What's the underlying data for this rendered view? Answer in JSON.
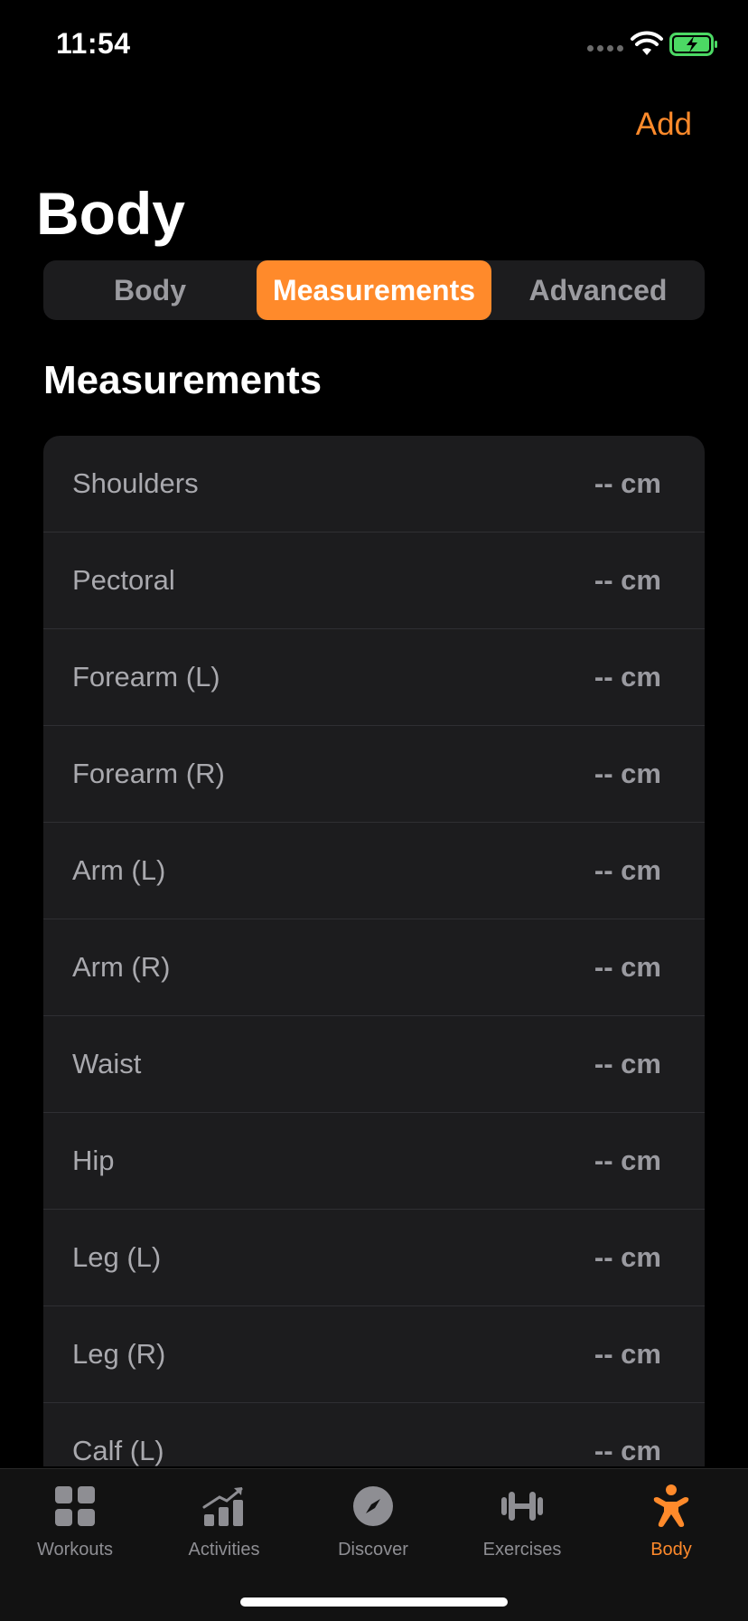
{
  "status_bar": {
    "time": "11:54"
  },
  "header": {
    "add_label": "Add",
    "title": "Body"
  },
  "segments": [
    {
      "label": "Body",
      "selected": false
    },
    {
      "label": "Measurements",
      "selected": true
    },
    {
      "label": "Advanced",
      "selected": false
    }
  ],
  "section": {
    "title": "Measurements"
  },
  "measurements": [
    {
      "label": "Shoulders",
      "value": "-- cm"
    },
    {
      "label": "Pectoral",
      "value": "-- cm"
    },
    {
      "label": "Forearm (L)",
      "value": "-- cm"
    },
    {
      "label": "Forearm (R)",
      "value": "-- cm"
    },
    {
      "label": "Arm (L)",
      "value": "-- cm"
    },
    {
      "label": "Arm (R)",
      "value": "-- cm"
    },
    {
      "label": "Waist",
      "value": "-- cm"
    },
    {
      "label": "Hip",
      "value": "-- cm"
    },
    {
      "label": "Leg (L)",
      "value": "-- cm"
    },
    {
      "label": "Leg (R)",
      "value": "-- cm"
    },
    {
      "label": "Calf (L)",
      "value": "-- cm"
    }
  ],
  "tab_bar": {
    "tabs": [
      {
        "label": "Workouts",
        "icon": "grid-icon",
        "active": false
      },
      {
        "label": "Activities",
        "icon": "trend-chart-icon",
        "active": false
      },
      {
        "label": "Discover",
        "icon": "compass-icon",
        "active": false
      },
      {
        "label": "Exercises",
        "icon": "dumbbell-icon",
        "active": false
      },
      {
        "label": "Body",
        "icon": "person-icon",
        "active": true
      }
    ]
  },
  "colors": {
    "accent": "#ff8a2b",
    "background": "#000000",
    "card": "#1c1c1e",
    "battery": "#4cd964"
  }
}
